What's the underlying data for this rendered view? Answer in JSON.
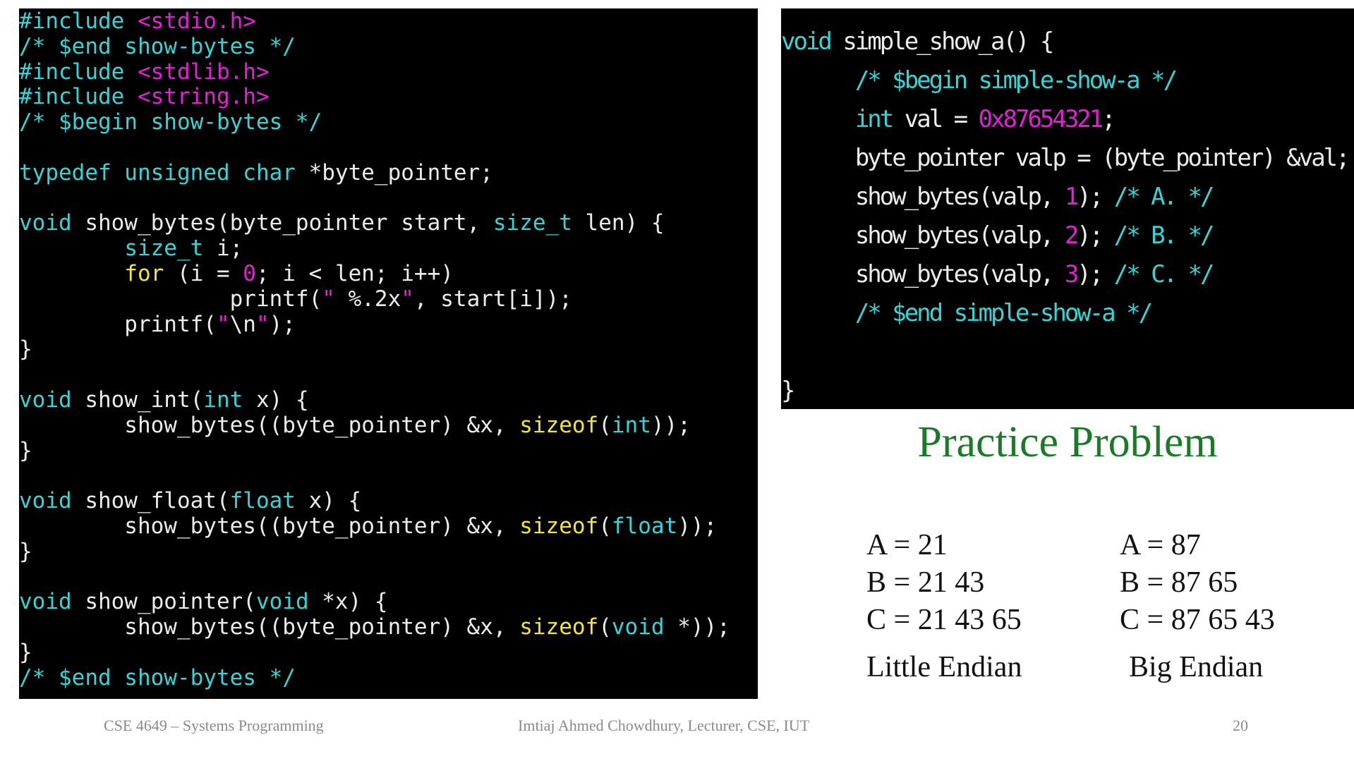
{
  "colors": {
    "code_background": "#000000",
    "code_default": "#ececec",
    "code_comment": "#33d6d6",
    "code_keyword": "#33d6d6",
    "code_string": "#e41fd6",
    "code_builtin": "#f2e534",
    "title_color": "#1b7a28"
  },
  "left_code": [
    [
      [
        "#include ",
        "cyan"
      ],
      [
        "<stdio.h>",
        "magenta"
      ]
    ],
    [
      [
        "/* $end show-bytes */",
        "cyan"
      ]
    ],
    [
      [
        "#include ",
        "cyan"
      ],
      [
        "<stdlib.h>",
        "magenta"
      ]
    ],
    [
      [
        "#include ",
        "cyan"
      ],
      [
        "<string.h>",
        "magenta"
      ]
    ],
    [
      [
        "/* $begin show-bytes */",
        "cyan"
      ]
    ],
    [],
    [
      [
        "typedef unsigned char",
        "cyan"
      ],
      [
        " *byte_pointer;",
        "white"
      ]
    ],
    [],
    [
      [
        "void",
        "cyan"
      ],
      [
        " show_bytes(byte_pointer start, ",
        "white"
      ],
      [
        "size_t",
        "cyan"
      ],
      [
        " len) {",
        "white"
      ]
    ],
    [
      [
        "        ",
        "white"
      ],
      [
        "size_t",
        "cyan"
      ],
      [
        " i;",
        "white"
      ]
    ],
    [
      [
        "        ",
        "white"
      ],
      [
        "for",
        "yellow"
      ],
      [
        " (i = ",
        "white"
      ],
      [
        "0",
        "magenta"
      ],
      [
        "; i < len; i++)",
        "white"
      ]
    ],
    [
      [
        "                printf(",
        "white"
      ],
      [
        "\" ",
        "magenta"
      ],
      [
        "%.2x",
        "white"
      ],
      [
        "\"",
        "magenta"
      ],
      [
        ", start[i]);",
        "white"
      ]
    ],
    [
      [
        "        printf(",
        "white"
      ],
      [
        "\"",
        "magenta"
      ],
      [
        "\\n",
        "white"
      ],
      [
        "\"",
        "magenta"
      ],
      [
        ");",
        "white"
      ]
    ],
    [
      [
        "}",
        "white"
      ]
    ],
    [],
    [
      [
        "void",
        "cyan"
      ],
      [
        " show_int(",
        "white"
      ],
      [
        "int",
        "cyan"
      ],
      [
        " x) {",
        "white"
      ]
    ],
    [
      [
        "        show_bytes((byte_pointer) &x, ",
        "white"
      ],
      [
        "sizeof",
        "yellow"
      ],
      [
        "(",
        "white"
      ],
      [
        "int",
        "cyan"
      ],
      [
        "));",
        "white"
      ]
    ],
    [
      [
        "}",
        "white"
      ]
    ],
    [],
    [
      [
        "void",
        "cyan"
      ],
      [
        " show_float(",
        "white"
      ],
      [
        "float",
        "cyan"
      ],
      [
        " x) {",
        "white"
      ]
    ],
    [
      [
        "        show_bytes((byte_pointer) &x, ",
        "white"
      ],
      [
        "sizeof",
        "yellow"
      ],
      [
        "(",
        "white"
      ],
      [
        "float",
        "cyan"
      ],
      [
        "));",
        "white"
      ]
    ],
    [
      [
        "}",
        "white"
      ]
    ],
    [],
    [
      [
        "void",
        "cyan"
      ],
      [
        " show_pointer(",
        "white"
      ],
      [
        "void",
        "cyan"
      ],
      [
        " *x) {",
        "white"
      ]
    ],
    [
      [
        "        show_bytes((byte_pointer) &x, ",
        "white"
      ],
      [
        "sizeof",
        "yellow"
      ],
      [
        "(",
        "white"
      ],
      [
        "void",
        "cyan"
      ],
      [
        " *));",
        "white"
      ]
    ],
    [
      [
        "}",
        "white"
      ]
    ],
    [
      [
        "/* $end show-bytes */",
        "cyan"
      ]
    ]
  ],
  "right_code": [
    [
      [
        "void",
        "cyan"
      ],
      [
        " simple_show_a() {",
        "white"
      ]
    ],
    [
      [
        "      ",
        "white"
      ],
      [
        "/* $begin simple-show-a */",
        "cyan"
      ]
    ],
    [
      [
        "      ",
        "white"
      ],
      [
        "int",
        "cyan"
      ],
      [
        " val = ",
        "white"
      ],
      [
        "0x87654321",
        "magenta"
      ],
      [
        ";",
        "white"
      ]
    ],
    [
      [
        "      byte_pointer valp = (byte_pointer) &val;",
        "white"
      ]
    ],
    [
      [
        "      show_bytes(valp, ",
        "white"
      ],
      [
        "1",
        "magenta"
      ],
      [
        "); ",
        "white"
      ],
      [
        "/* A. */",
        "cyan"
      ]
    ],
    [
      [
        "      show_bytes(valp, ",
        "white"
      ],
      [
        "2",
        "magenta"
      ],
      [
        "); ",
        "white"
      ],
      [
        "/* B. */",
        "cyan"
      ]
    ],
    [
      [
        "      show_bytes(valp, ",
        "white"
      ],
      [
        "3",
        "magenta"
      ],
      [
        "); ",
        "white"
      ],
      [
        "/* C. */",
        "cyan"
      ]
    ],
    [
      [
        "      ",
        "white"
      ],
      [
        "/* $end simple-show-a */",
        "cyan"
      ]
    ],
    [],
    [
      [
        "}",
        "white"
      ]
    ]
  ],
  "title": "Practice Problem",
  "little_endian": {
    "answers": [
      "A = 21",
      "B = 21 43",
      "C = 21 43 65"
    ],
    "label": "Little Endian"
  },
  "big_endian": {
    "answers": [
      "A = 87",
      "B = 87 65",
      "C = 87 65 43"
    ],
    "label": "Big Endian"
  },
  "footer": {
    "course": "CSE 4649 – Systems Programming",
    "author": "Imtiaj Ahmed Chowdhury, Lecturer, CSE, IUT",
    "page": "20"
  }
}
